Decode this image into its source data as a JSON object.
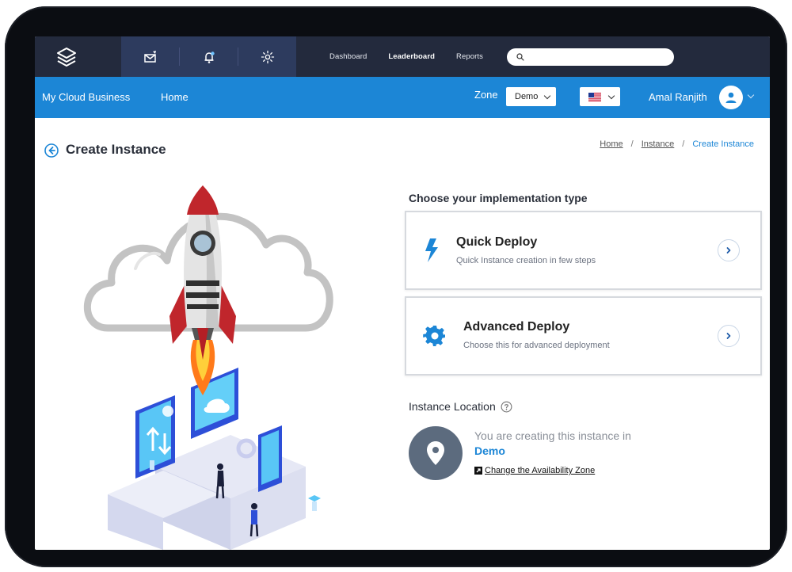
{
  "nav": {
    "links": [
      "Dashboard",
      "Leaderboard",
      "Reports"
    ],
    "active": "Leaderboard",
    "search_placeholder": ""
  },
  "bluebar": {
    "brand": "My Cloud Business",
    "home": "Home",
    "zone_label": "Zone",
    "zone_value": "Demo",
    "username": "Amal Ranjith"
  },
  "page": {
    "title": "Create Instance",
    "breadcrumb": [
      "Home",
      "Instance",
      "Create Instance"
    ]
  },
  "implementation": {
    "heading": "Choose your implementation type",
    "options": [
      {
        "title": "Quick Deploy",
        "subtitle": "Quick Instance creation in few steps",
        "icon": "lightning-icon"
      },
      {
        "title": "Advanced Deploy",
        "subtitle": "Choose this for advanced deployment",
        "icon": "gear-icon"
      }
    ]
  },
  "location": {
    "heading": "Instance Location",
    "text": "You are creating this instance in",
    "zone": "Demo",
    "change_link": "Change the Availability Zone"
  },
  "colors": {
    "topnav": "#232a3d",
    "blue": "#1c86d6",
    "pin": "#5c6b7e"
  }
}
